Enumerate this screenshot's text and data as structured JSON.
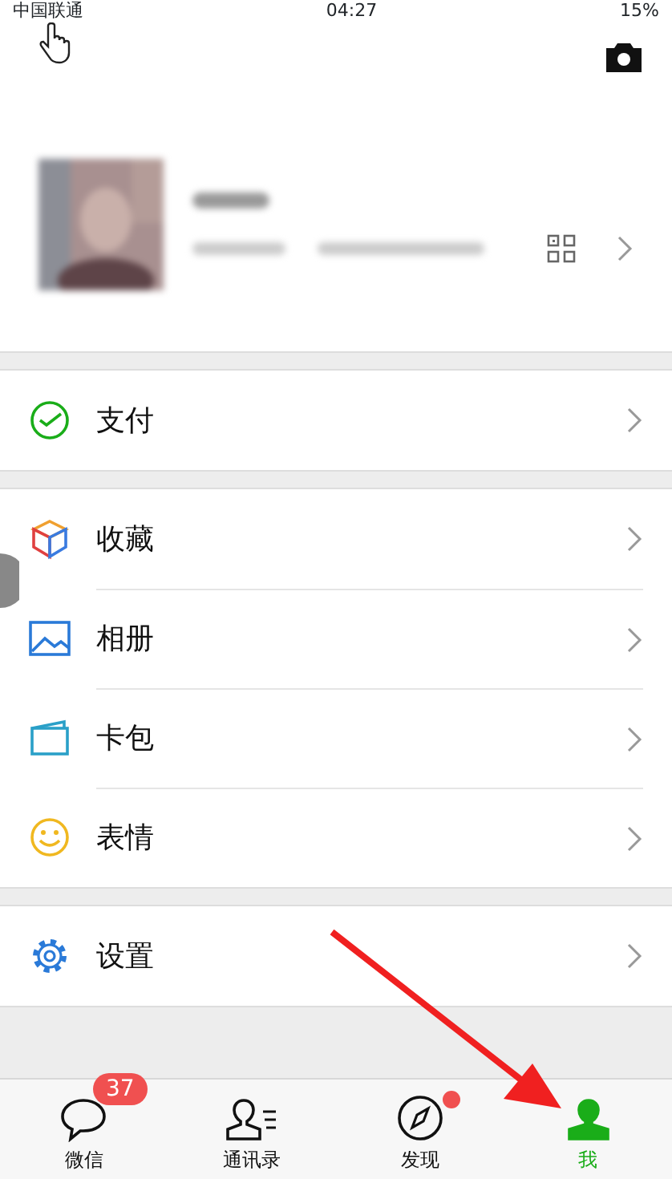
{
  "status_bar": {
    "carrier": "中国联通",
    "time": "04:27",
    "battery": "15%"
  },
  "menu_groups": [
    [
      {
        "label": "支付"
      }
    ],
    [
      {
        "label": "收藏"
      },
      {
        "label": "相册"
      },
      {
        "label": "卡包"
      },
      {
        "label": "表情"
      }
    ],
    [
      {
        "label": "设置"
      }
    ]
  ],
  "tabs": [
    {
      "label": "微信",
      "selected": false,
      "badge": "37",
      "dot": false
    },
    {
      "label": "通讯录",
      "selected": false,
      "dot": false
    },
    {
      "label": "发现",
      "selected": false,
      "dot": true
    },
    {
      "label": "我",
      "selected": true,
      "dot": false
    }
  ]
}
